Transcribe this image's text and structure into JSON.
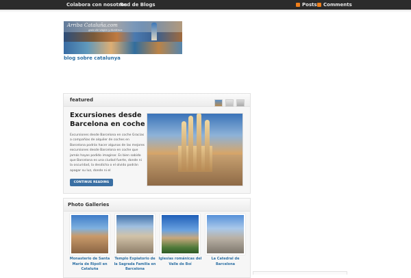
{
  "topnav": {
    "items": [
      "Colabora con nosotros",
      "Red de Blogs"
    ],
    "posts_label": "Posts",
    "comments_label": "Comments"
  },
  "header": {
    "logo_text": "Arriba Cataluña.com",
    "logo_subtext": "guía de viajes y destinos",
    "tagline": "blog sobre catalunya"
  },
  "featured": {
    "heading": "featured",
    "title": "Excursiones desde Barcelona en coche",
    "excerpt": "Excursiones desde Barcelona en coche Gracias a compañías de alquiler de coches en Barcelona podrás hacer algunas de las mejores excursiones desde Barcelona en coche que jamás hayas podido imaginar. Es bien sabido que Barcelona es una ciudad fuerte, donde ni la oscuridad, la desdicha o el olvido podrán apagar su luz, donde ni el",
    "button_label": "CONTINUE READING"
  },
  "gallery": {
    "heading": "Photo Galleries",
    "items": [
      {
        "caption": "Monasterio de Santa María de Ripoll en Cataluña"
      },
      {
        "caption": "Templo Expiatorio de la Sagrada Familia en Barcelona"
      },
      {
        "caption": "Iglesias románicas del Valle de Boí"
      },
      {
        "caption": "La Catedral de Barcelona"
      }
    ]
  },
  "colors": {
    "topbar_bg": "#2b2b2b",
    "link_blue": "#2c6fa3",
    "button_bg": "#3a6fa3",
    "rss_orange": "#f07f1a"
  }
}
